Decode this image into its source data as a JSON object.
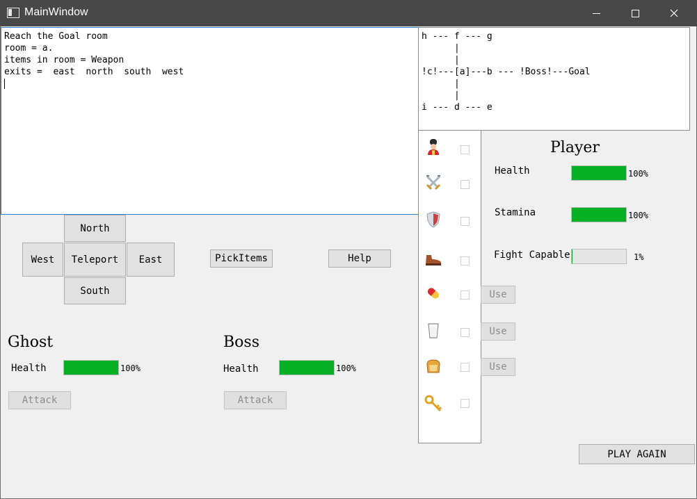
{
  "window": {
    "title": "MainWindow"
  },
  "console": {
    "lines": [
      "Reach the Goal room",
      "room = a.",
      "items in room = Weapon",
      "exits =  east  north  south  west"
    ]
  },
  "map": {
    "lines": [
      "h --- f --- g",
      "      |",
      "      |",
      "!c!---[a]---b --- !Boss!---Goal",
      "      |",
      "      |",
      "i --- d --- e"
    ]
  },
  "inventory": {
    "items": [
      {
        "icon": "guard-icon",
        "checked": false
      },
      {
        "icon": "crossed-swords-icon",
        "checked": false
      },
      {
        "icon": "shield-icon",
        "checked": false
      },
      {
        "icon": "boot-icon",
        "checked": false
      },
      {
        "icon": "pill-icon",
        "checked": false
      },
      {
        "icon": "milk-glass-icon",
        "checked": false
      },
      {
        "icon": "bread-icon",
        "checked": false
      },
      {
        "icon": "key-icon",
        "checked": false
      }
    ],
    "use_label": "Use"
  },
  "movement": {
    "north": "North",
    "west": "West",
    "teleport": "Teleport",
    "east": "East",
    "south": "South"
  },
  "actions": {
    "pick_items": "PickItems",
    "help": "Help",
    "play_again": "PLAY AGAIN"
  },
  "player": {
    "title": "Player",
    "health_label": "Health",
    "health_value": 100,
    "health_text": "100%",
    "stamina_label": "Stamina",
    "stamina_value": 100,
    "stamina_text": "100%",
    "fight_label": "Fight Capable",
    "fight_value": 1,
    "fight_text": "1%"
  },
  "ghost": {
    "title": "Ghost",
    "health_label": "Health",
    "health_value": 100,
    "health_text": "100%",
    "attack_label": "Attack"
  },
  "boss": {
    "title": "Boss",
    "health_label": "Health",
    "health_value": 100,
    "health_text": "100%",
    "attack_label": "Attack"
  },
  "colors": {
    "bar_fill": "#06b025",
    "titlebar": "#484848",
    "console_border": "#2a7fd4"
  }
}
